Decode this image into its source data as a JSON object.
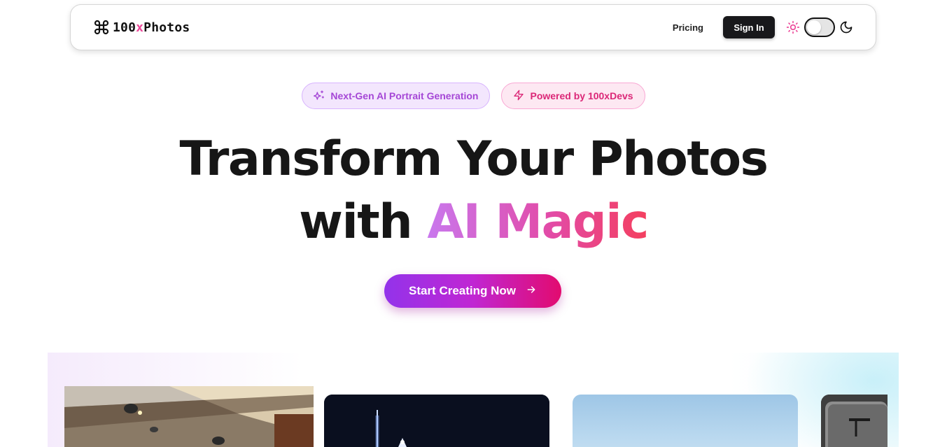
{
  "brand": {
    "prefix": "100",
    "accent": "x",
    "suffix": "Photos"
  },
  "nav": {
    "pricing": "Pricing",
    "sign_in": "Sign In"
  },
  "badges": [
    {
      "label": "Next-Gen AI Portrait Generation",
      "icon": "sparkles-icon"
    },
    {
      "label": "Powered by 100xDevs",
      "icon": "zap-icon"
    }
  ],
  "hero": {
    "line1": "Transform Your Photos",
    "line2_plain": "with ",
    "line2_highlight": "AI Magic"
  },
  "cta": {
    "label": "Start Creating Now",
    "icon": "arrow-right-icon"
  },
  "theme": {
    "mode": "light",
    "toggle_on": false
  },
  "gallery": {
    "cards": [
      {
        "subject": "aircraft-cabin"
      },
      {
        "subject": "city-night-skyline"
      },
      {
        "subject": "blue-sky"
      },
      {
        "subject": "dark-interior"
      }
    ]
  },
  "colors": {
    "accent_pink": "#ec4899",
    "gradient_start": "#9333ea",
    "gradient_end": "#e20b6f",
    "dark_button": "#18181b"
  }
}
